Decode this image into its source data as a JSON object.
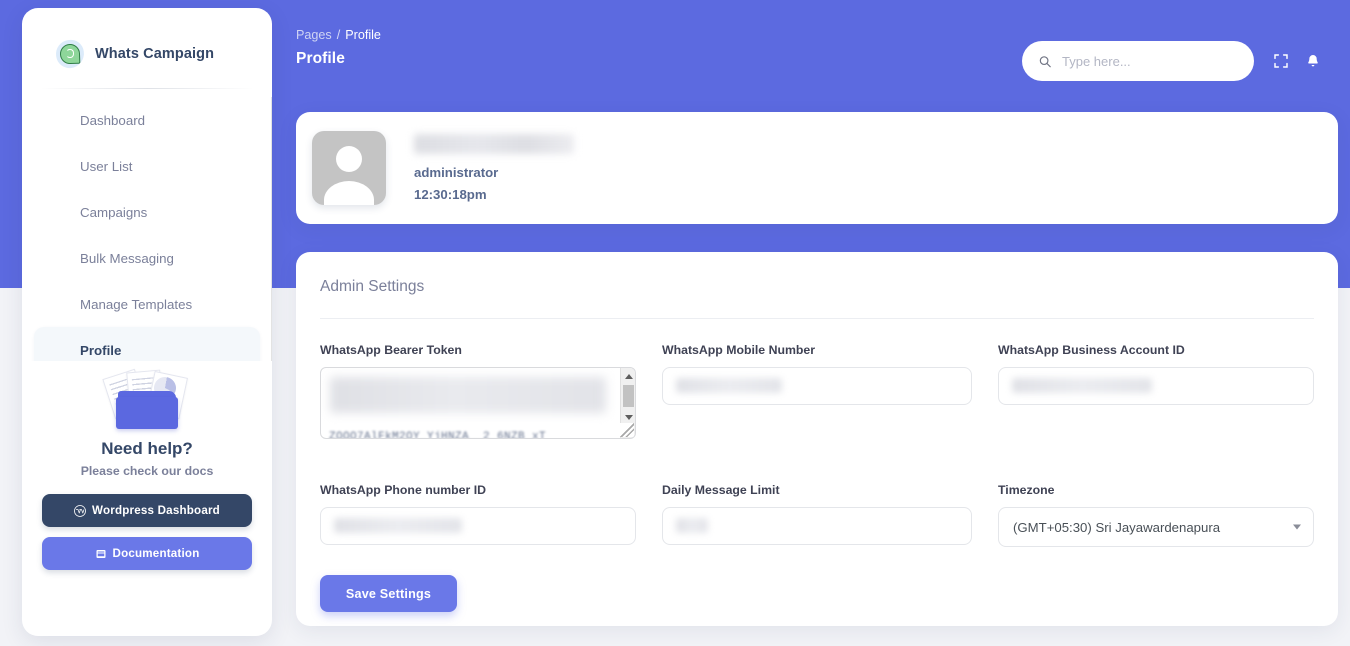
{
  "brand": {
    "name": "Whats Campaign",
    "logo_icon": "whatsapp-icon"
  },
  "sidebar": {
    "items": [
      {
        "label": "Dashboard",
        "active": false
      },
      {
        "label": "User List",
        "active": false
      },
      {
        "label": "Campaigns",
        "active": false
      },
      {
        "label": "Bulk Messaging",
        "active": false
      },
      {
        "label": "Manage Templates",
        "active": false
      },
      {
        "label": "Profile",
        "active": true
      }
    ],
    "help": {
      "title": "Need help?",
      "subtitle": "Please check our docs",
      "wordpress_button": "Wordpress Dashboard",
      "wordpress_icon": "wordpress-icon",
      "documentation_button": "Documentation",
      "documentation_icon": "book-icon"
    }
  },
  "topbar": {
    "breadcrumb_root": "Pages",
    "breadcrumb_sep": "/",
    "breadcrumb_current": "Profile",
    "page_title": "Profile",
    "search": {
      "placeholder": "Type here...",
      "value": "",
      "icon": "search-icon"
    },
    "expand_icon": "fullscreen-icon",
    "bell_icon": "notification-bell-icon"
  },
  "profile": {
    "avatar_icon": "user-avatar-icon",
    "name": "",
    "name_redacted": true,
    "role": "administrator",
    "time": "12:30:18pm"
  },
  "settings": {
    "title": "Admin Settings",
    "fields": [
      {
        "label": "WhatsApp Bearer Token",
        "value": "",
        "redacted": true,
        "type": "textarea"
      },
      {
        "label": "WhatsApp Mobile Number",
        "value": "",
        "redacted": true,
        "type": "text"
      },
      {
        "label": "WhatsApp Business Account ID",
        "value": "",
        "redacted": true,
        "type": "text"
      },
      {
        "label": "WhatsApp Phone number ID",
        "value": "",
        "redacted": true,
        "type": "text"
      },
      {
        "label": "Daily Message Limit",
        "value": "",
        "redacted": true,
        "type": "text"
      },
      {
        "label": "Timezone",
        "value": "(GMT+05:30) Sri Jayawardenapura",
        "redacted": false,
        "type": "select"
      }
    ],
    "save_label": "Save Settings"
  },
  "colors": {
    "brand_purple": "#5c6ae0",
    "accent_blue": "#6a78e8",
    "dark_navy": "#344767",
    "muted_text": "#7b809a",
    "page_bg": "#f2f3f7"
  }
}
